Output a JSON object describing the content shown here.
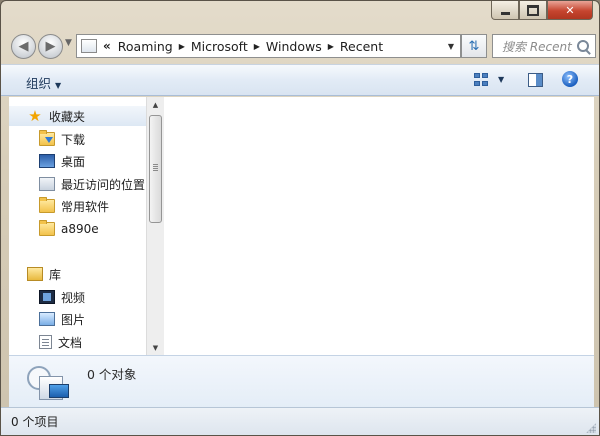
{
  "window": {
    "minimize_icon": "minimize-icon",
    "maximize_icon": "maximize-icon",
    "close_label": "✕"
  },
  "navigation": {
    "back_icon": "back-arrow-icon",
    "forward_icon": "forward-arrow-icon"
  },
  "address": {
    "overflow": "«",
    "crumbs": [
      "Roaming",
      "Microsoft",
      "Windows",
      "Recent"
    ]
  },
  "search": {
    "placeholder": "搜索 Recent"
  },
  "toolbar": {
    "organize_label": "组织"
  },
  "sidebar": {
    "favorites": {
      "label": "收藏夹",
      "items": [
        {
          "label": "下载",
          "icon": "download-folder-icon"
        },
        {
          "label": "桌面",
          "icon": "desktop-icon"
        },
        {
          "label": "最近访问的位置",
          "icon": "recent-places-icon"
        },
        {
          "label": "常用软件",
          "icon": "folder-icon"
        },
        {
          "label": "a890e",
          "icon": "folder-icon"
        }
      ]
    },
    "libraries": {
      "label": "库",
      "items": [
        {
          "label": "视频",
          "icon": "video-library-icon"
        },
        {
          "label": "图片",
          "icon": "pictures-library-icon"
        },
        {
          "label": "文档",
          "icon": "documents-library-icon"
        }
      ]
    }
  },
  "details": {
    "text": "0 个对象"
  },
  "status": {
    "text": "0 个项目"
  },
  "colors": {
    "command_bar": "#dfe9f5",
    "accent": "#1e395b",
    "title_bar": "#d7cdb8"
  }
}
